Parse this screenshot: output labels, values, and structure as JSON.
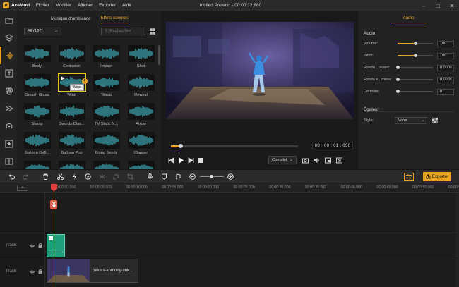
{
  "app": {
    "name": "AceMovi",
    "window_title": "Untitled Project* - 00:00:12.880",
    "menu": [
      "Fichier",
      "Modifier",
      "Afficher",
      "Exporter",
      "Aide"
    ]
  },
  "library": {
    "tabs": [
      "Musique d'ambiance",
      "Effets sonores"
    ],
    "active_tab": 1,
    "filter": "All (167)",
    "search_placeholder": "Rechercher",
    "tooltip": "Wind",
    "items": [
      "Body",
      "Explosion",
      "Impact",
      "Shot",
      "Smash Glass",
      "Wind",
      "Wood",
      "Rewind",
      "Stamp",
      "Swords Clas...",
      "TV Static N...",
      "Arrow",
      "Balloon Defl...",
      "Balloon Pop",
      "Boing Bendy",
      "Clapper",
      "",
      "",
      "",
      ""
    ],
    "selected_index": 5
  },
  "preview": {
    "timecode": "00 : 00 : 01 . 050",
    "progress_fraction": 0.08,
    "quality": "Complet"
  },
  "right_panel": {
    "tab": "Audio",
    "audio_section": "Audio",
    "params": [
      {
        "label": "Volume:",
        "value": "100",
        "fraction": 0.5,
        "show_fill": true
      },
      {
        "label": "Pitch:",
        "value": "100",
        "fraction": 0.5,
        "show_fill": true
      },
      {
        "label": "Fondu ...avant:",
        "value": "0.000s",
        "fraction": 0.0,
        "show_fill": false
      },
      {
        "label": "Fondu e...rrière:",
        "value": "0.000s",
        "fraction": 0.0,
        "show_fill": false
      },
      {
        "label": "Denoise:",
        "value": "0",
        "fraction": 0.0,
        "show_fill": false
      }
    ],
    "eq_section": "Égaleur",
    "style_label": "Style:",
    "style_value": "None"
  },
  "toolbar": {
    "export_label": "Exporter"
  },
  "timeline": {
    "ruler": [
      "00:00:00.000",
      "00:00:05.000",
      "00:00:10.000",
      "00:00:15.000",
      "00:00:20.000",
      "00:00:25.000",
      "00:00:30.000",
      "00:00:35.000",
      "00:00:40.000",
      "00:00:45.000",
      "00:00:50.000",
      "00:00:55.000"
    ],
    "tracks": [
      "Track",
      "Track"
    ],
    "video_clip_name": "pexels-anthony-shk..."
  },
  "colors": {
    "accent": "#e9a521",
    "playhead": "#e53c3c",
    "audio_clip": "#1e9e7a"
  }
}
